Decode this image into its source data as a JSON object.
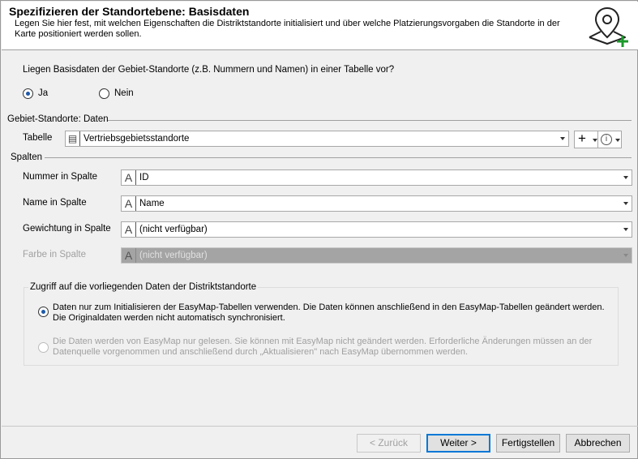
{
  "header": {
    "title": "Spezifizieren der Standortebene: Basisdaten",
    "description": "Legen Sie hier fest, mit welchen Eigenschaften die Distriktstandorte initialisiert und über welche Platzierungsvorgaben die Standorte in der Karte positioniert werden sollen.",
    "icon": "map-pin-plus-icon"
  },
  "question": "Liegen Basisdaten der Gebiet-Standorte (z.B. Nummern und Namen) in einer Tabelle vor?",
  "radio_ja": "Ja",
  "radio_nein": "Nein",
  "section_data": "Gebiet-Standorte: Daten",
  "table_label": "Tabelle",
  "table_value": "Vertriebsgebietsstandorte",
  "section_columns": "Spalten",
  "fields": [
    {
      "label": "Nummer in Spalte",
      "icon": "A",
      "value": "ID"
    },
    {
      "label": "Name in Spalte",
      "icon": "A",
      "value": "Name"
    },
    {
      "label": "Gewichtung in Spalte",
      "icon": "A",
      "value": "(nicht verfügbar)"
    },
    {
      "label": "Farbe in Spalte",
      "icon": "A",
      "value": "(nicht verfügbar)"
    }
  ],
  "access_group": {
    "title": "Zugriff auf die vorliegenden Daten der Distriktstandorte",
    "option1": "Daten nur zum Initialisieren der EasyMap-Tabellen verwenden. Die Daten können anschließend in den EasyMap-Tabellen geändert werden. Die Originaldaten werden nicht automatisch synchronisiert.",
    "option2": "Die Daten werden von EasyMap nur gelesen. Sie können mit EasyMap nicht geändert werden. Erforderliche Änderungen müssen an der Datenquelle vorgenommen und anschließend durch „Aktualisieren\" nach EasyMap übernommen werden."
  },
  "buttons": {
    "back": "< Zurück",
    "next": "Weiter >",
    "finish": "Fertigstellen",
    "cancel": "Abbrechen"
  },
  "colors": {
    "accent": "#1e5aa8",
    "add_green": "#1a9a2a"
  }
}
